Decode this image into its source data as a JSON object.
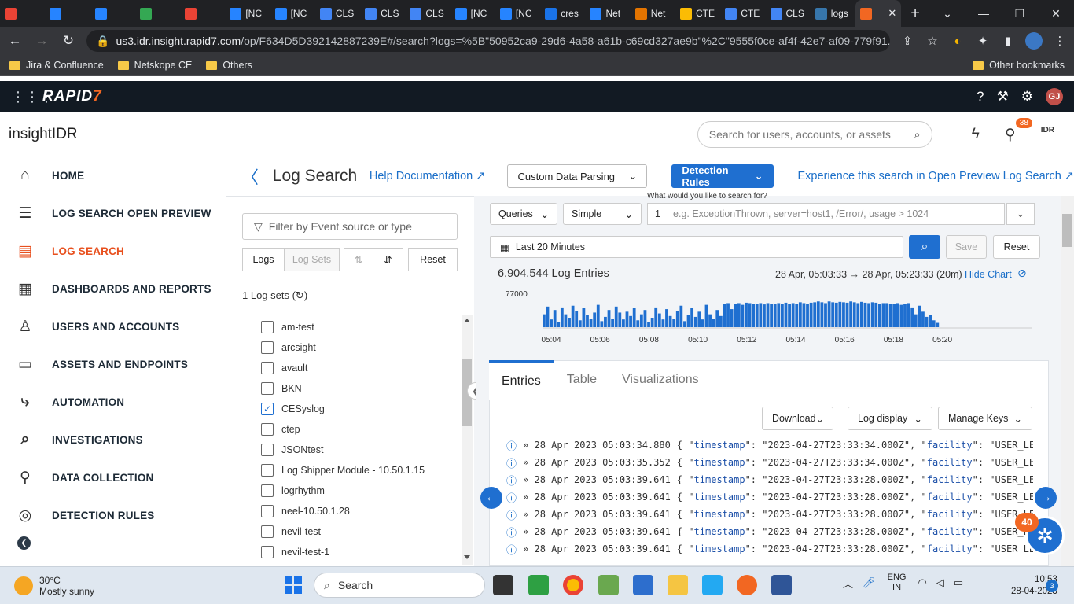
{
  "browser": {
    "tabs": [
      {
        "label": "",
        "color": "#ea4335"
      },
      {
        "label": "",
        "color": "#2684ff"
      },
      {
        "label": "",
        "color": "#2684ff"
      },
      {
        "label": "",
        "color": "#34a853"
      },
      {
        "label": "",
        "color": "#ea4335"
      },
      {
        "label": "[NC",
        "color": "#2684ff"
      },
      {
        "label": "[NC",
        "color": "#2684ff"
      },
      {
        "label": "CLS",
        "color": "#4285f4"
      },
      {
        "label": "CLS",
        "color": "#4285f4"
      },
      {
        "label": "CLS",
        "color": "#4285f4"
      },
      {
        "label": "[NC",
        "color": "#2684ff"
      },
      {
        "label": "[NC",
        "color": "#2684ff"
      },
      {
        "label": "cres",
        "color": "#1a73e8"
      },
      {
        "label": "Net",
        "color": "#2684ff"
      },
      {
        "label": "Net",
        "color": "#e37400"
      },
      {
        "label": "CTE",
        "color": "#fbbc04"
      },
      {
        "label": "CTE",
        "color": "#4285f4"
      },
      {
        "label": "CLS",
        "color": "#4285f4"
      },
      {
        "label": "logs",
        "color": "#3776ab"
      },
      {
        "label": "",
        "color": "#f26722"
      }
    ],
    "url_host": "us3.idr.insight.rapid7.com",
    "url_path": "/op/F634D5D392142887239E#/search?logs=%5B\"50952ca9-29d6-4a58-a61b-c69cd327ae9b\"%2C\"9555f0ce-af4f-42e7-af09-779f91...",
    "bookmarks": [
      "Jira & Confluence",
      "Netskope CE",
      "Others"
    ],
    "other_bookmarks": "Other bookmarks"
  },
  "topbar": {
    "logo": "RAPID",
    "logo_mark": "7",
    "user_initials": "GJ"
  },
  "header": {
    "brand": "insightIDR",
    "search_placeholder": "Search for users, accounts, or assets",
    "notif_count": "38",
    "idr_label": "IDR"
  },
  "sidebar": {
    "items": [
      {
        "label": "HOME",
        "icon": "⌂"
      },
      {
        "label": "LOG SEARCH OPEN PREVIEW",
        "icon": "☰"
      },
      {
        "label": "LOG SEARCH",
        "icon": "▤"
      },
      {
        "label": "DASHBOARDS AND REPORTS",
        "icon": "▦"
      },
      {
        "label": "USERS AND ACCOUNTS",
        "icon": "♙"
      },
      {
        "label": "ASSETS AND ENDPOINTS",
        "icon": "▭"
      },
      {
        "label": "AUTOMATION",
        "icon": "⤷"
      },
      {
        "label": "INVESTIGATIONS",
        "icon": "⌕"
      },
      {
        "label": "DATA COLLECTION",
        "icon": "⚲"
      },
      {
        "label": "DETECTION RULES",
        "icon": "◎"
      }
    ]
  },
  "logsearch": {
    "title": "Log Search",
    "help": "Help Documentation",
    "custom_parsing": "Custom Data Parsing",
    "detection_rules": "Detection Rules",
    "experience": "Experience this search in Open Preview Log Search",
    "filter_placeholder": "Filter by Event source or type",
    "btn_logs": "Logs",
    "btn_logsets": "Log Sets",
    "btn_reset": "Reset",
    "logsets_count": "1 Log sets (↻)",
    "sets": [
      {
        "name": "am-test",
        "checked": false
      },
      {
        "name": "arcsight",
        "checked": false
      },
      {
        "name": "avault",
        "checked": false
      },
      {
        "name": "BKN",
        "checked": false
      },
      {
        "name": "CESyslog",
        "checked": true
      },
      {
        "name": "ctep",
        "checked": false
      },
      {
        "name": "JSONtest",
        "checked": false
      },
      {
        "name": "Log Shipper Module - 10.50.1.15",
        "checked": false
      },
      {
        "name": "logrhythm",
        "checked": false
      },
      {
        "name": "neel-10.50.1.28",
        "checked": false
      },
      {
        "name": "nevil-test",
        "checked": false
      },
      {
        "name": "nevil-test-1",
        "checked": false
      }
    ]
  },
  "query": {
    "label": "What would you like to search for?",
    "queries": "Queries",
    "mode": "Simple",
    "line": "1",
    "placeholder": "e.g. ExceptionThrown, server=host1, /Error/, usage > 1024",
    "time": "Last 20 Minutes",
    "save": "Save",
    "reset": "Reset",
    "entries_count": "6,904,544 Log Entries",
    "range": "28 Apr, 05:03:33 → 28 Apr, 05:23:33 (20m)",
    "hide_chart": "Hide Chart"
  },
  "chart_data": {
    "type": "bar",
    "ymax_label": "77000",
    "x_ticks": [
      "05:04",
      "05:06",
      "05:08",
      "05:10",
      "05:12",
      "05:14",
      "05:16",
      "05:18",
      "05:20"
    ],
    "ylim": [
      0,
      77000
    ],
    "values": [
      30000,
      48000,
      18000,
      40000,
      12000,
      46000,
      30000,
      22000,
      50000,
      38000,
      16000,
      44000,
      28000,
      20000,
      34000,
      52000,
      14000,
      24000,
      40000,
      20000,
      48000,
      34000,
      18000,
      36000,
      26000,
      44000,
      16000,
      30000,
      40000,
      12000,
      22000,
      46000,
      32000,
      18000,
      42000,
      26000,
      20000,
      38000,
      50000,
      14000,
      28000,
      44000,
      24000,
      36000,
      18000,
      52000,
      30000,
      20000,
      40000,
      26000,
      54000,
      56000,
      42000,
      55000,
      56000,
      52000,
      57000,
      56000,
      54000,
      55000,
      56000,
      53000,
      56000,
      55000,
      54000,
      56000,
      55000,
      57000,
      55000,
      56000,
      54000,
      58000,
      56000,
      55000,
      57000,
      58000,
      60000,
      58000,
      56000,
      60000,
      58000,
      57000,
      59000,
      58000,
      57000,
      60000,
      58000,
      56000,
      59000,
      57000,
      56000,
      58000,
      57000,
      55000,
      56000,
      56000,
      54000,
      55000,
      56000,
      52000,
      54000,
      56000,
      46000,
      30000,
      50000,
      36000,
      24000,
      28000,
      16000,
      10000
    ]
  },
  "results": {
    "tabs": [
      "Entries",
      "Table",
      "Visualizations"
    ],
    "download": "Download",
    "log_display": "Log display",
    "manage_keys": "Manage Keys",
    "rows": [
      {
        "ts": "» 28 Apr 2023 05:03:34.880",
        "val": "\"2023-04-27T23:33:34.000Z\""
      },
      {
        "ts": "» 28 Apr 2023 05:03:35.352",
        "val": "\"2023-04-27T23:33:34.000Z\""
      },
      {
        "ts": "» 28 Apr 2023 05:03:39.641",
        "val": "\"2023-04-27T23:33:28.000Z\""
      },
      {
        "ts": "» 28 Apr 2023 05:03:39.641",
        "val": "\"2023-04-27T23:33:28.000Z\""
      },
      {
        "ts": "» 28 Apr 2023 05:03:39.641",
        "val": "\"2023-04-27T23:33:28.000Z\""
      },
      {
        "ts": "» 28 Apr 2023 05:03:39.641",
        "val": "\"2023-04-27T23:33:28.000Z\""
      },
      {
        "ts": "» 28 Apr 2023 05:03:39.641",
        "val": "\"2023-04-27T23:33:28.000Z\""
      }
    ],
    "help_badge": "40"
  },
  "taskbar": {
    "temp": "30°C",
    "weather": "Mostly sunny",
    "search": "Search",
    "lang1": "ENG",
    "lang2": "IN",
    "time": "10:53",
    "date": "28-04-2023",
    "notifications": "3"
  }
}
